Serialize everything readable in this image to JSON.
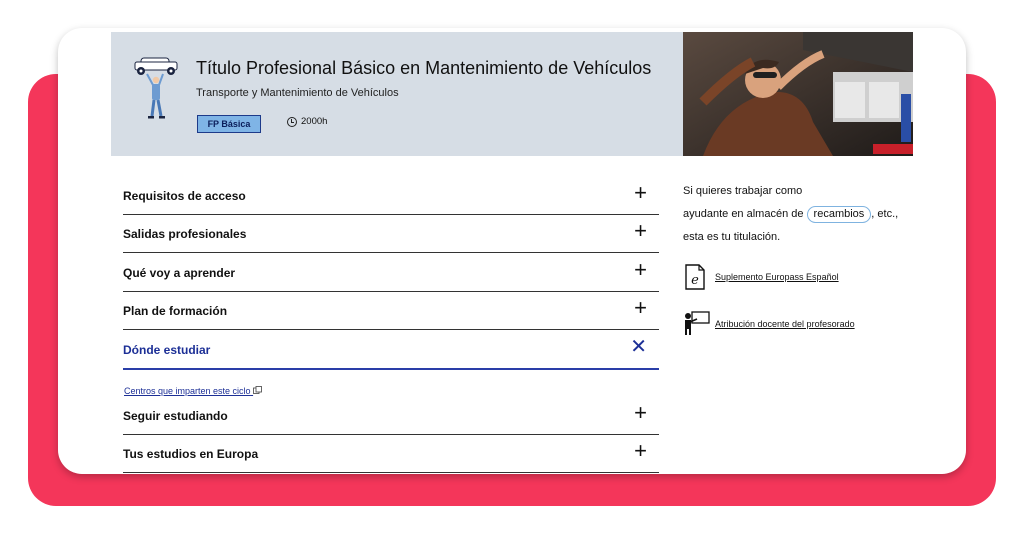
{
  "header": {
    "title": "Título Profesional Básico en Mantenimiento de Vehículos",
    "subtitle": "Transporte y Mantenimiento de Vehículos",
    "badge": "FP Básica",
    "hours": "2000h"
  },
  "accordion": {
    "items": [
      {
        "label": "Requisitos de acceso",
        "icon": "+"
      },
      {
        "label": "Salidas profesionales",
        "icon": "+"
      },
      {
        "label": "Qué voy a aprender",
        "icon": "+"
      },
      {
        "label": "Plan de formación",
        "icon": "+"
      },
      {
        "label": "Dónde estudiar",
        "icon": "✕"
      },
      {
        "label": "Seguir estudiando",
        "icon": "+"
      },
      {
        "label": "Tus estudios en Europa",
        "icon": "+"
      }
    ],
    "centros_link": "Centros que imparten este ciclo"
  },
  "sidebar": {
    "line1": "Si quieres trabajar como",
    "line2_pre": "ayudante en almacén de",
    "line2_highlight": "recambios",
    "line2_post": ", etc.,",
    "line3": "esta es tu titulación.",
    "links": [
      {
        "label": "Suplemento Europass Español",
        "icon": "e"
      },
      {
        "label": "Atribución docente del profesorado",
        "icon": "teacher-icon"
      }
    ]
  },
  "colors": {
    "card_red": "#f4365a",
    "hero_bg": "#d6dde5",
    "badge_bg": "#7fb4e6",
    "accent_blue": "#1c2f96"
  }
}
